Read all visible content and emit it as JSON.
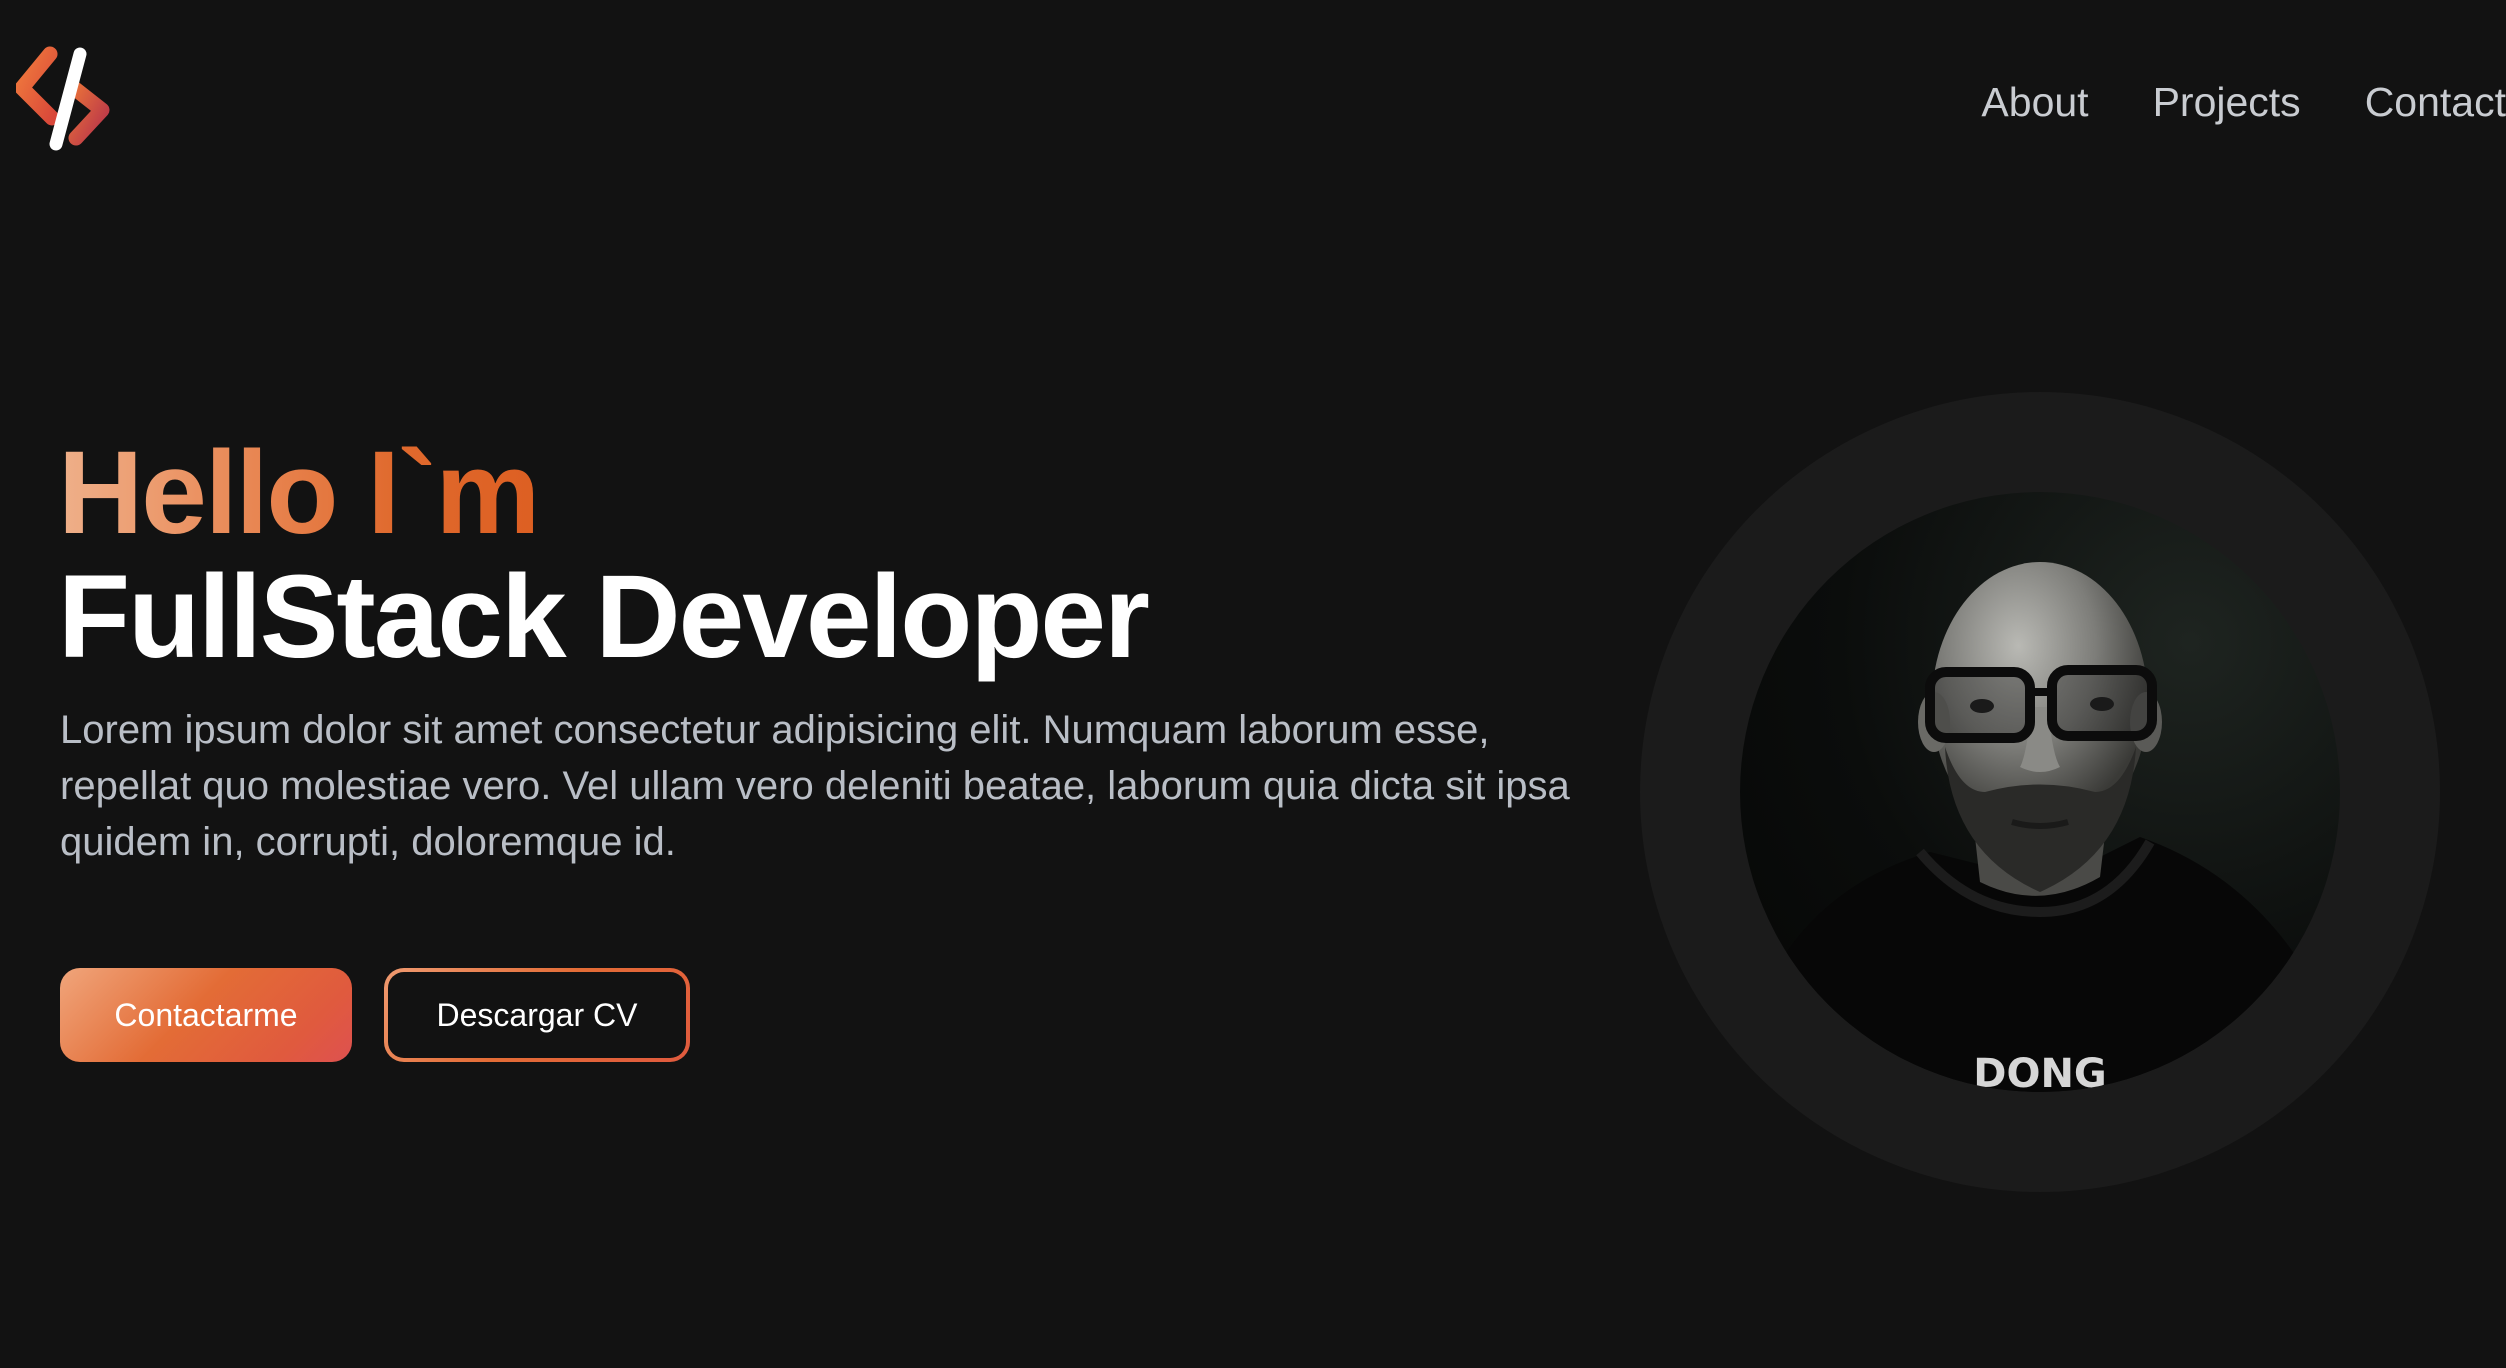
{
  "nav": {
    "items": [
      {
        "label": "About"
      },
      {
        "label": "Projects"
      },
      {
        "label": "Contact"
      }
    ]
  },
  "hero": {
    "greeting": "Hello I`m",
    "role": "FullStack Developer",
    "description": "Lorem ipsum dolor sit amet consectetur adipisicing elit. Numquam laborum esse, repellat quo molestiae vero. Vel ullam vero deleniti beatae, laborum quia dicta sit ipsa quidem in, corrupti, doloremque id."
  },
  "buttons": {
    "contact_label": "Contactarme",
    "cv_label": "Descargar CV"
  },
  "icons": {
    "logo": "code-slash-logo-icon",
    "avatar": "profile-photo"
  },
  "colors": {
    "background": "#121212",
    "accent_start": "#efb08a",
    "accent_end": "#dd5f22",
    "nav_text": "#c9ccd1",
    "body_text": "#b9bec6"
  }
}
